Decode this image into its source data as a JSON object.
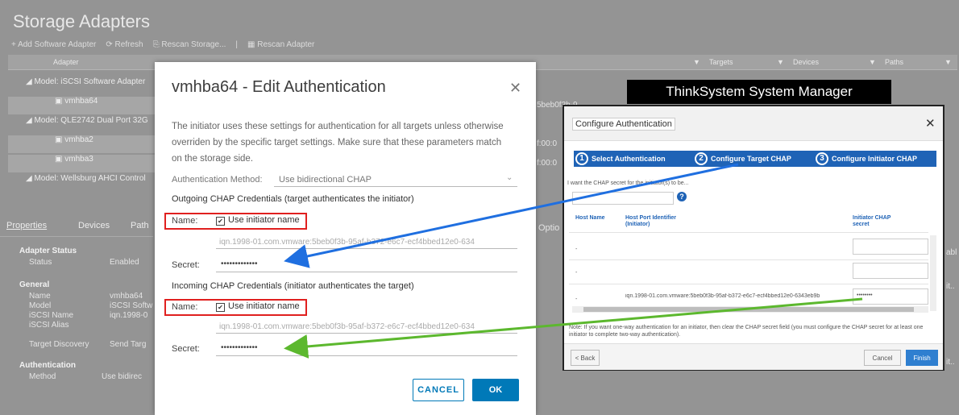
{
  "background": {
    "title": "Storage Adapters",
    "toolbar": [
      "Add Software Adapter",
      "Refresh",
      "Rescan Storage...",
      "Rescan Adapter"
    ],
    "table_headers": {
      "adapter": "Adapter",
      "targets": "Targets",
      "devices": "Devices",
      "paths": "Paths"
    },
    "rows": [
      {
        "label": "Model: iSCSI Software Adapter",
        "type": "group"
      },
      {
        "label": "vmhba64",
        "type": "item"
      },
      {
        "label": "Model: QLE2742 Dual Port 32G",
        "type": "group"
      },
      {
        "label": "vmhba2",
        "type": "item"
      },
      {
        "label": "vmhba3",
        "type": "item"
      },
      {
        "label": "Model: Wellsburg AHCI Control",
        "type": "group"
      }
    ],
    "peek_text": [
      "5beb0f3b-9",
      "f:00:0",
      "f:00:0",
      "Optio",
      "abl",
      "it..",
      "it.."
    ],
    "tabs": [
      "Properties",
      "Devices",
      "Path"
    ],
    "properties": {
      "adapter_status_heading": "Adapter Status",
      "status_label": "Status",
      "status_value": "Enabled",
      "general_heading": "General",
      "name_label": "Name",
      "name_value": "vmhba64",
      "model_label": "Model",
      "model_value": "iSCSI Softw",
      "iscsi_name_label": "iSCSI Name",
      "iscsi_name_value": "iqn.1998-0",
      "iscsi_alias_label": "iSCSI Alias",
      "target_discovery_label": "Target Discovery",
      "target_discovery_value": "Send Targ",
      "auth_heading": "Authentication",
      "method_label": "Method",
      "method_value": "Use bidirec"
    }
  },
  "dialog": {
    "title": "vmhba64 - Edit Authentication",
    "description": "The initiator uses these settings for authentication for all targets unless otherwise overriden by the specific target settings. Make sure that these parameters match on the storage side.",
    "auth_method_label": "Authentication Method:",
    "auth_method_value": "Use bidirectional CHAP",
    "outgoing_heading": "Outgoing CHAP Credentials (target authenticates the initiator)",
    "incoming_heading": "Incoming CHAP Credentials (initiator authenticates the target)",
    "name_label": "Name:",
    "use_initiator_name": "Use initiator name",
    "iqn_value": "iqn.1998-01.com.vmware:5beb0f3b-95af-b372-e6c7-ecf4bbed12e0-634",
    "secret_label": "Secret:",
    "secret_value": "•••••••••••••",
    "cancel_label": "CANCEL",
    "ok_label": "OK"
  },
  "ssm": {
    "banner": "ThinkSystem System Manager",
    "title": "Configure Authentication",
    "steps": [
      {
        "num": "1",
        "label": "Select Authentication"
      },
      {
        "num": "2",
        "label": "Configure Target CHAP"
      },
      {
        "num": "3",
        "label": "Configure Initiator CHAP"
      }
    ],
    "prompt": "I want the CHAP secret for the initiator(s) to be...",
    "col_host_name": "Host Name",
    "col_host_port": "Host Port Identifier (Initiator)",
    "col_initiator_secret": "Initiator CHAP secret",
    "rows": [
      {
        "host": "-",
        "port": "",
        "secret": ""
      },
      {
        "host": "-",
        "port": "",
        "secret": ""
      },
      {
        "host": "-",
        "port": "iqn.1998-01.com.vmware:5beb0f3b-95af-b372-e6c7-ecf4bbed12e0-6343eb9b",
        "secret": "••••••••"
      }
    ],
    "note": "Note: If you want one-way authentication for an initiator, then clear the CHAP secret field (you must configure the CHAP secret for at least one initiator to complete two-way authentication).",
    "back_label": "< Back",
    "cancel_label": "Cancel",
    "finish_label": "Finish"
  },
  "colors": {
    "accent": "#0079b8",
    "highlight_box": "#e0201f",
    "arrow_blue": "#1f6fe0",
    "arrow_green": "#5cb82e",
    "step_bar": "#1f63b6"
  }
}
